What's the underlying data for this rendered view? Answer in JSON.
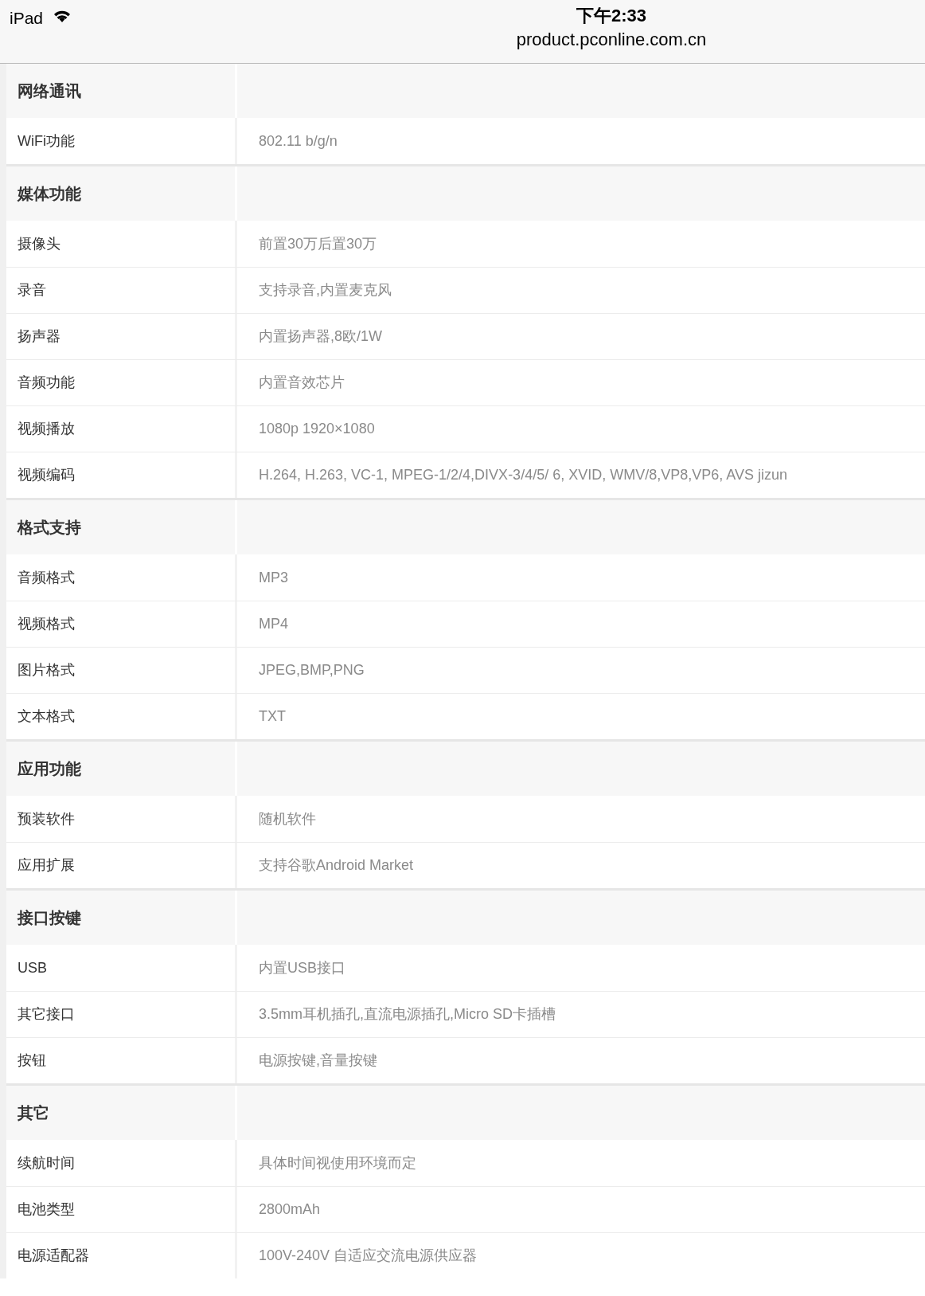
{
  "status_bar": {
    "device": "iPad",
    "time": "下午2:33",
    "url": "product.pconline.com.cn"
  },
  "sections": [
    {
      "title": "网络通讯",
      "rows": [
        {
          "label": "WiFi功能",
          "value": "802.11 b/g/n"
        }
      ]
    },
    {
      "title": "媒体功能",
      "rows": [
        {
          "label": "摄像头",
          "value": "前置30万后置30万"
        },
        {
          "label": "录音",
          "value": "支持录音,内置麦克风"
        },
        {
          "label": "扬声器",
          "value": "内置扬声器,8欧/1W"
        },
        {
          "label": "音频功能",
          "value": "内置音效芯片"
        },
        {
          "label": "视频播放",
          "value": "1080p 1920×1080"
        },
        {
          "label": "视频编码",
          "value": "H.264, H.263, VC-1, MPEG-1/2/4,DIVX-3/4/5/ 6, XVID, WMV/8,VP8,VP6, AVS jizun"
        }
      ]
    },
    {
      "title": "格式支持",
      "rows": [
        {
          "label": "音频格式",
          "value": "MP3"
        },
        {
          "label": "视频格式",
          "value": "MP4"
        },
        {
          "label": "图片格式",
          "value": "JPEG,BMP,PNG"
        },
        {
          "label": "文本格式",
          "value": "TXT"
        }
      ]
    },
    {
      "title": "应用功能",
      "rows": [
        {
          "label": "预装软件",
          "value": "随机软件"
        },
        {
          "label": "应用扩展",
          "value": "支持谷歌Android Market"
        }
      ]
    },
    {
      "title": "接口按键",
      "rows": [
        {
          "label": "USB",
          "value": "内置USB接口"
        },
        {
          "label": "其它接口",
          "value": "3.5mm耳机插孔,直流电源插孔,Micro SD卡插槽"
        },
        {
          "label": "按钮",
          "value": "电源按键,音量按键"
        }
      ]
    },
    {
      "title": "其它",
      "rows": [
        {
          "label": "续航时间",
          "value": "具体时间视使用环境而定"
        },
        {
          "label": "电池类型",
          "value": "2800mAh"
        },
        {
          "label": "电源适配器",
          "value": "100V-240V 自适应交流电源供应器"
        }
      ]
    }
  ]
}
